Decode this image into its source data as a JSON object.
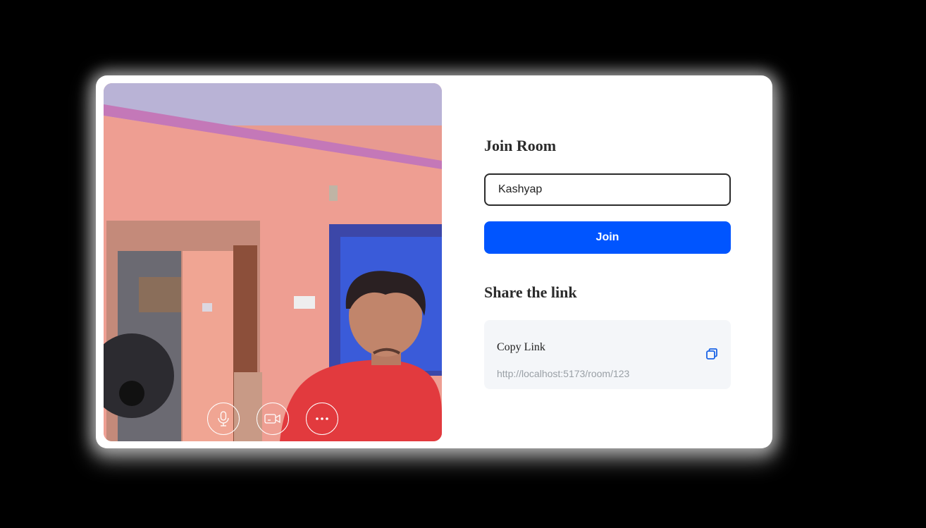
{
  "join": {
    "heading": "Join Room",
    "name_value": "Kashyap",
    "button_label": "Join"
  },
  "share": {
    "heading": "Share the link",
    "copy_label": "Copy Link",
    "url": "http://localhost:5173/room/123"
  },
  "video_controls": [
    {
      "icon": "microphone-icon"
    },
    {
      "icon": "camera-icon"
    },
    {
      "icon": "more-options-icon"
    }
  ],
  "colors": {
    "accent": "#0055ff",
    "copy_icon": "#1a63e6",
    "card_bg": "#ffffff",
    "page_bg": "#000000"
  }
}
